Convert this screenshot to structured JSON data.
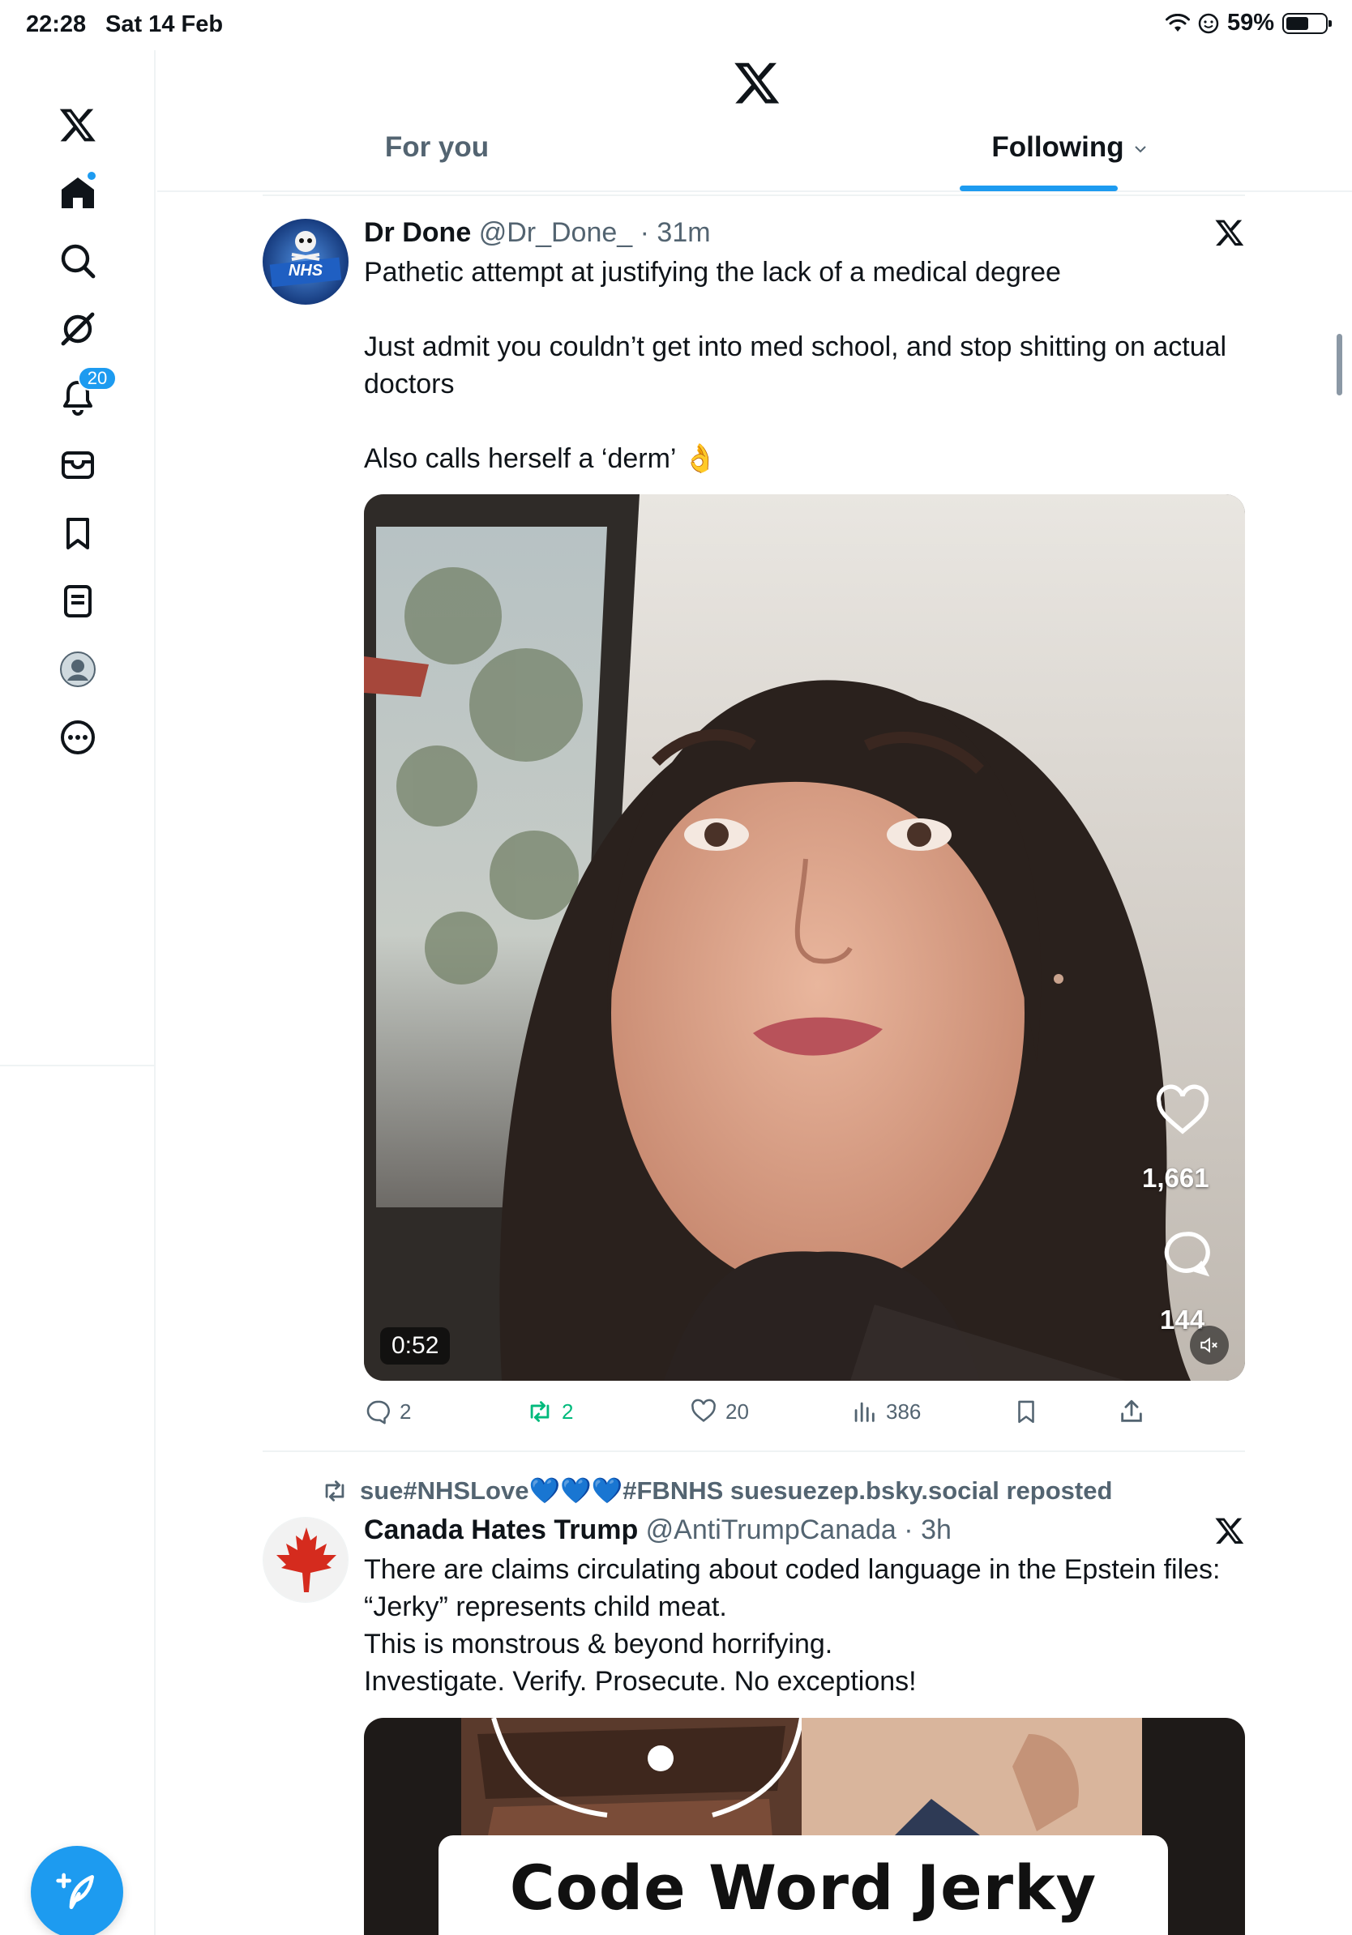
{
  "status_bar": {
    "time": "22:28",
    "date": "Sat 14 Feb",
    "battery": "59%"
  },
  "nav": {
    "items": [
      "home",
      "search",
      "grok",
      "notifications",
      "messages",
      "bookmarks",
      "lists",
      "profile",
      "more"
    ],
    "notifications_badge": "20"
  },
  "header": {
    "tabs": [
      {
        "label": "For you",
        "active": false
      },
      {
        "label": "Following",
        "active": true
      }
    ]
  },
  "tweets": [
    {
      "name": "Dr Done",
      "handle": "@Dr_Done_",
      "time": "· 31m",
      "text_lines": [
        "Pathetic attempt at justifying the lack of a medical degree",
        "Just admit you couldn’t get into med school, and stop shitting on actual",
        "doctors",
        "Also calls herself a ‘derm’ 👌"
      ],
      "media": {
        "duration": "0:52",
        "likes": "1,661",
        "comments": "144"
      },
      "actions": {
        "replies": "2",
        "reposts": "2",
        "likes": "20",
        "views": "386"
      }
    },
    {
      "repost_by": "sue#NHSLove💙💙💙#FBNHS suesuezep.bsky.social reposted",
      "name": "Canada Hates Trump",
      "handle": "@AntiTrumpCanada",
      "time": "· 3h",
      "text_lines": [
        "There are claims circulating about coded language in the Epstein files:",
        "“Jerky” represents child meat.",
        "This is monstrous & beyond horrifying.",
        "Investigate. Verify. Prosecute. No exceptions!"
      ],
      "media": {
        "caption": "Code Word Jerky"
      }
    }
  ],
  "colors": {
    "accent": "#1d9bf0",
    "text": "#0f1419",
    "muted": "#536471",
    "repost": "#00ba7c"
  }
}
